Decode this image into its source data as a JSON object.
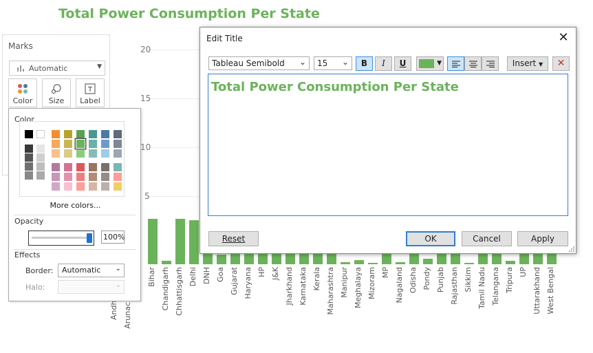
{
  "sheet": {
    "title": "Total Power Consumption Per State",
    "title_color": "#6bb35a"
  },
  "marks": {
    "title": "Marks",
    "mark_type": "Automatic",
    "buttons": [
      "Color",
      "Size",
      "Label"
    ]
  },
  "color_popup": {
    "color_section": "Color",
    "more_colors": "More colors...",
    "opacity_section": "Opacity",
    "opacity_value": "100%",
    "opacity_level": 1.0,
    "effects_section": "Effects",
    "border_label": "Border:",
    "border_value": "Automatic",
    "halo_label": "Halo:",
    "halo_value": "",
    "selected_swatch": "#6bb35a"
  },
  "chart": {
    "y_ticks": [
      "20",
      "15",
      "10",
      "5"
    ],
    "bar_color": "#6bb35a"
  },
  "chart_data": {
    "type": "bar",
    "categories": [
      "Andhra Pradesh",
      "Arunachal Pradesh",
      "Bihar",
      "Chandigarh",
      "Chhattisgarh",
      "Delhi",
      "DNH",
      "Goa",
      "Gujarat",
      "Haryana",
      "HP",
      "J&K",
      "Jharkhand",
      "Karnataka",
      "Kerala",
      "Maharashtra",
      "Manipur",
      "Meghalaya",
      "Mizoram",
      "MP",
      "Nagaland",
      "Odisha",
      "Pondy",
      "Punjab",
      "Rajasthan",
      "Sikkim",
      "Tamil Nadu",
      "Telangana",
      "Tripura",
      "UP",
      "Uttarakhand",
      "West Bengal"
    ],
    "category_labels": [
      "Andhr",
      "Arunach",
      "Bihar",
      "Chandigarh",
      "Chhattisgarh",
      "Delhi",
      "DNH",
      "Goa",
      "Gujarat",
      "Haryana",
      "HP",
      "J&K",
      "Jharkhand",
      "Karnataka",
      "Kerala",
      "Maharashtra",
      "Manipur",
      "Meghalaya",
      "Mizoram",
      "MP",
      "Nagaland",
      "Odisha",
      "Pondy",
      "Punjab",
      "Rajasthan",
      "Sikkim",
      "Tamil Nadu",
      "Telangana",
      "Tripura",
      "UP",
      "Uttarakhand",
      "West Bengal"
    ],
    "values": [
      null,
      null,
      4.2,
      0.3,
      4.2,
      4.1,
      1.9,
      0.9,
      4.5,
      4.5,
      4.5,
      4.5,
      4.5,
      4.5,
      4.5,
      4.5,
      0.2,
      0.4,
      0.1,
      4.5,
      0.2,
      4.5,
      0.5,
      4.5,
      4.5,
      0.1,
      4.5,
      4.5,
      0.3,
      4.5,
      4.5,
      4.5
    ],
    "ylim": [
      0,
      20
    ]
  },
  "dialog": {
    "title": "Edit Title",
    "font": "Tableau Semibold",
    "size": "15",
    "bold": "B",
    "italic": "I",
    "underline": "U",
    "insert": "Insert",
    "text": "Total Power Consumption Per State",
    "text_color": "#6bb35a",
    "buttons": {
      "reset": "Reset",
      "ok": "OK",
      "cancel": "Cancel",
      "apply": "Apply"
    }
  },
  "swatches": {
    "col1": [
      "#000000",
      "#3a3a3a",
      "#555555",
      "#6f6f6f",
      "#888888"
    ],
    "col2": [
      "#ffffff",
      "#e5e5e5",
      "#cfcfcf",
      "#bdbdbd",
      "#a9a9a9"
    ],
    "top": [
      [
        "#f28e2b",
        "#f5a85a",
        "#f8c18a"
      ],
      [
        "#b8a22b",
        "#c9b556",
        "#dccb86"
      ],
      [
        "#59a14f",
        "#6bb35a",
        "#8ccd7b"
      ],
      [
        "#499894",
        "#6ab0ab",
        "#86bcb6"
      ],
      [
        "#4e79a7",
        "#6d9bc7",
        "#a0cbe8"
      ],
      [
        "#5f6b7a",
        "#7d8896",
        "#9ca7b3"
      ]
    ],
    "bottom": [
      [
        "#b07aa1",
        "#c895b9",
        "#d4a6c8"
      ],
      [
        "#d37295",
        "#e291ad",
        "#fabfd2"
      ],
      [
        "#e15759",
        "#f07d7f",
        "#ff9d9a"
      ],
      [
        "#9c755f",
        "#b48b76",
        "#d7b5a6"
      ],
      [
        "#79706e",
        "#958c89",
        "#bab0ac"
      ],
      [
        "#79b7b2",
        "#ff9d9a",
        "#f1ce63"
      ]
    ]
  }
}
